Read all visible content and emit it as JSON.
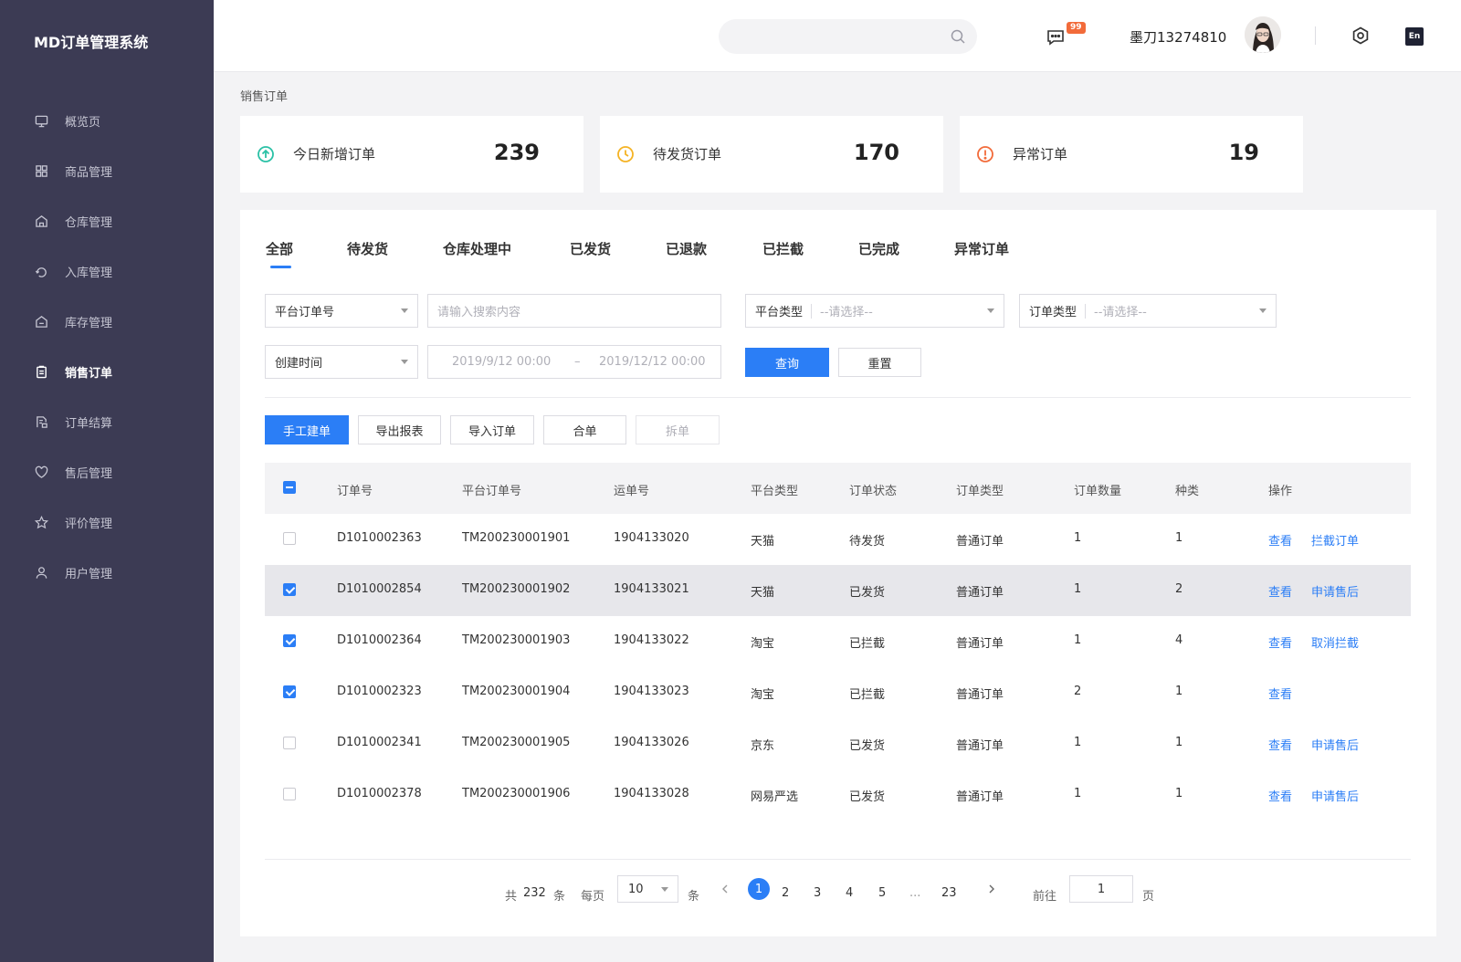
{
  "app": {
    "title": "MD订单管理系统"
  },
  "sidebar": {
    "items": [
      {
        "label": "概览页",
        "icon": "monitor-icon"
      },
      {
        "label": "商品管理",
        "icon": "grid-icon"
      },
      {
        "label": "仓库管理",
        "icon": "warehouse-icon"
      },
      {
        "label": "入库管理",
        "icon": "inbound-icon"
      },
      {
        "label": "库存管理",
        "icon": "inventory-icon"
      },
      {
        "label": "销售订单",
        "icon": "clipboard-icon",
        "active": true
      },
      {
        "label": "订单结算",
        "icon": "settlement-icon"
      },
      {
        "label": "售后管理",
        "icon": "heart-icon"
      },
      {
        "label": "评价管理",
        "icon": "star-icon"
      },
      {
        "label": "用户管理",
        "icon": "user-icon"
      }
    ]
  },
  "header": {
    "search_placeholder": "",
    "badge": "99",
    "username": "墨刀13274810",
    "lang": "En"
  },
  "breadcrumb": "销售订单",
  "stats": [
    {
      "label": "今日新增订单",
      "value": "239",
      "icon": "arrow-up-circle-icon",
      "color": "#2bc1a6"
    },
    {
      "label": "待发货订单",
      "value": "170",
      "icon": "clock-icon",
      "color": "#f5b324"
    },
    {
      "label": "异常订单",
      "value": "19",
      "icon": "alert-circle-icon",
      "color": "#f26b3a"
    }
  ],
  "tabs": [
    "全部",
    "待发货",
    "仓库处理中",
    "已发货",
    "已退款",
    "已拦截",
    "已完成",
    "异常订单"
  ],
  "filters": {
    "order_field": "平台订单号",
    "search_placeholder": "请输入搜索内容",
    "platform_label": "平台类型",
    "platform_placeholder": "--请选择--",
    "order_type_label": "订单类型",
    "order_type_placeholder": "--请选择--",
    "time_field": "创建时间",
    "date_start": "2019/9/12 00:00",
    "date_sep": "–",
    "date_end": "2019/12/12 00:00",
    "query": "查询",
    "reset": "重置"
  },
  "actions": {
    "manual": "手工建单",
    "export": "导出报表",
    "import": "导入订单",
    "merge": "合单",
    "split": "拆单"
  },
  "table": {
    "headers": [
      "订单号",
      "平台订单号",
      "运单号",
      "平台类型",
      "订单状态",
      "订单类型",
      "订单数量",
      "种类",
      "操作"
    ],
    "rows": [
      {
        "id": "D1010002363",
        "platform_id": "TM200230001901",
        "waybill": "1904133020",
        "platform": "天猫",
        "status": "待发货",
        "type": "普通订单",
        "qty": "1",
        "kinds": "1",
        "checked": false,
        "op1": "查看",
        "op2": "拦截订单"
      },
      {
        "id": "D1010002854",
        "platform_id": "TM200230001902",
        "waybill": "1904133021",
        "platform": "天猫",
        "status": "已发货",
        "type": "普通订单",
        "qty": "1",
        "kinds": "2",
        "checked": true,
        "highlight": true,
        "op1": "查看",
        "op2": "申请售后"
      },
      {
        "id": "D1010002364",
        "platform_id": "TM200230001903",
        "waybill": "1904133022",
        "platform": "淘宝",
        "status": "已拦截",
        "type": "普通订单",
        "qty": "1",
        "kinds": "4",
        "checked": true,
        "op1": "查看",
        "op2": "取消拦截"
      },
      {
        "id": "D1010002323",
        "platform_id": "TM200230001904",
        "waybill": "1904133023",
        "platform": "淘宝",
        "status": "已拦截",
        "type": "普通订单",
        "qty": "2",
        "kinds": "1",
        "checked": true,
        "op1": "查看",
        "op2": ""
      },
      {
        "id": "D1010002341",
        "platform_id": "TM200230001905",
        "waybill": "1904133026",
        "platform": "京东",
        "status": "已发货",
        "type": "普通订单",
        "qty": "1",
        "kinds": "1",
        "checked": false,
        "op1": "查看",
        "op2": "申请售后"
      },
      {
        "id": "D1010002378",
        "platform_id": "TM200230001906",
        "waybill": "1904133028",
        "platform": "网易严选",
        "status": "已发货",
        "type": "普通订单",
        "qty": "1",
        "kinds": "1",
        "checked": false,
        "op1": "查看",
        "op2": "申请售后"
      }
    ]
  },
  "pagination": {
    "total_prefix": "共",
    "total": "232",
    "total_suffix": "条",
    "per_page_label": "每页",
    "per_page": "10",
    "per_page_suffix": "条",
    "pages": [
      "1",
      "2",
      "3",
      "4",
      "5",
      "...",
      "23"
    ],
    "goto_label": "前往",
    "goto_value": "1",
    "goto_suffix": "页"
  }
}
